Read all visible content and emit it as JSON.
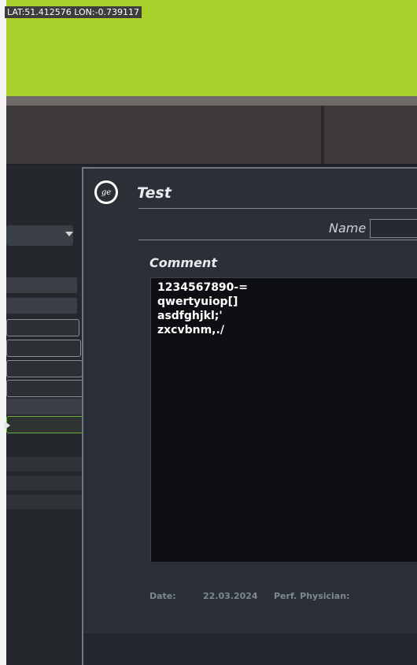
{
  "overlay": {
    "geotag": "LAT:51.412576 LON:-0.739117"
  },
  "dialog": {
    "title": "Test",
    "logo_icon": "ge-logo",
    "name_label": "Name",
    "name_value": "",
    "comment_label": "Comment",
    "comment_lines": [
      "1234567890-=",
      "qwertyuiop[]",
      "asdfghjkl;'",
      "zxcvbnm,./"
    ],
    "date_label": "Date:",
    "date_value": "22.03.2024",
    "physician_label": "Perf. Physician:"
  }
}
